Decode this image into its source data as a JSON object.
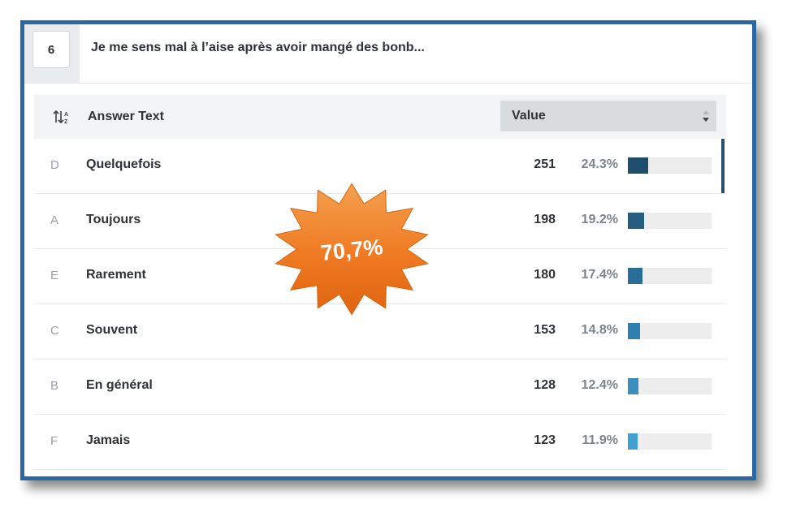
{
  "question": {
    "number": "6",
    "title": "Je me sens mal à l’aise après avoir mangé des bonb..."
  },
  "table": {
    "header_answer": "Answer Text",
    "header_value": "Value",
    "sort_icon": "sort-alpha-icon",
    "caret_icon": "sort-caret-icon",
    "rows": [
      {
        "letter": "D",
        "label": "Quelquefois",
        "count": "251",
        "percent": "24.3%",
        "fraction": 0.243,
        "color": "#1f4e6b"
      },
      {
        "letter": "A",
        "label": "Toujours",
        "count": "198",
        "percent": "19.2%",
        "fraction": 0.192,
        "color": "#255e82"
      },
      {
        "letter": "E",
        "label": "Rarement",
        "count": "180",
        "percent": "17.4%",
        "fraction": 0.174,
        "color": "#2a6d96"
      },
      {
        "letter": "C",
        "label": "Souvent",
        "count": "153",
        "percent": "14.8%",
        "fraction": 0.148,
        "color": "#317fae"
      },
      {
        "letter": "B",
        "label": "En général",
        "count": "128",
        "percent": "12.4%",
        "fraction": 0.124,
        "color": "#398fc0"
      },
      {
        "letter": "F",
        "label": "Jamais",
        "count": "123",
        "percent": "11.9%",
        "fraction": 0.119,
        "color": "#429fd0"
      }
    ]
  },
  "badge": {
    "text": "70,7%",
    "color": "#f07d2b"
  }
}
